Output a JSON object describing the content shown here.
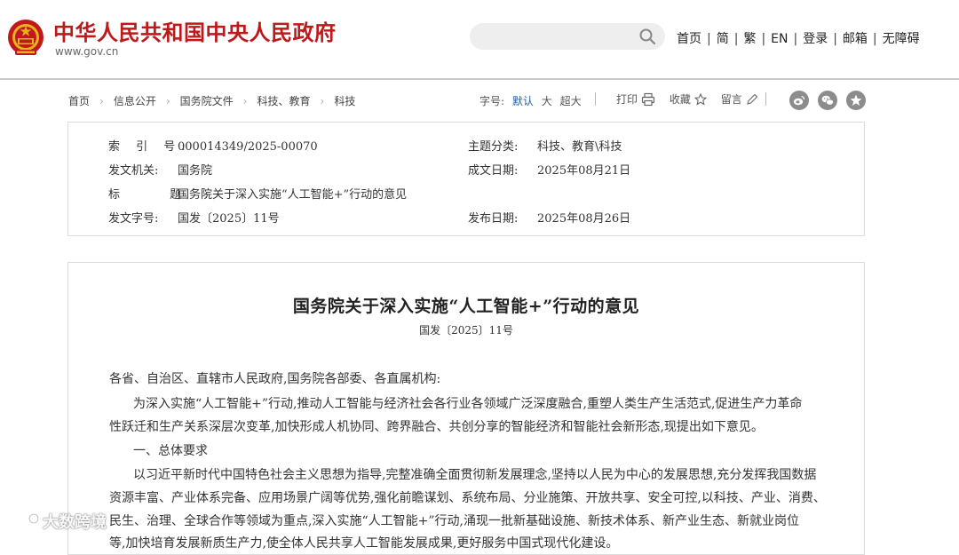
{
  "header": {
    "site_title": "中华人民共和国中央人民政府",
    "site_url": "www.gov.cn",
    "nav": [
      "首页",
      "简",
      "繁",
      "EN",
      "登录",
      "邮箱",
      "无障碍"
    ]
  },
  "breadcrumb": [
    "首页",
    "信息公开",
    "国务院文件",
    "科技、教育",
    "科技"
  ],
  "font_size": {
    "label": "字号:",
    "options": [
      "默认",
      "大",
      "超大"
    ],
    "active_color": "#1e5fa8"
  },
  "tools": {
    "print": "打印",
    "favorite": "收藏",
    "comment": "留言"
  },
  "share_icons": [
    "weibo-icon",
    "wechat-icon",
    "qzone-icon"
  ],
  "info": {
    "index_label": "索  引  号:",
    "index_value": "000014349/2025-00070",
    "topic_label": "主题分类:",
    "topic_value": "科技、教育\\科技",
    "issuer_label": "发文机关:",
    "issuer_value": "国务院",
    "written_label": "成文日期:",
    "written_value": "2025年08月21日",
    "title_label": "标    题:",
    "title_value": "国务院关于深入实施“人工智能+”行动的意见",
    "docno_label": "发文字号:",
    "docno_value": "国发〔2025〕11号",
    "published_label": "发布日期:",
    "published_value": "2025年08月26日"
  },
  "article": {
    "title": "国务院关于深入实施“人工智能+”行动的意见",
    "doc_number": "国发〔2025〕11号",
    "lines": [
      "各省、自治区、直辖市人民政府,国务院各部委、各直属机构:",
      "为深入实施“人工智能+”行动,推动人工智能与经济社会各行业各领域广泛深度融合,重塑人类生产生活范式,促进生产力革命",
      "性跃迁和生产关系深层次变革,加快形成人机协同、跨界融合、共创分享的智能经济和智能社会新形态,现提出如下意见。",
      "一、总体要求",
      "以习近平新时代中国特色社会主义思想为指导,完整准确全面贯彻新发展理念,坚持以人民为中心的发展思想,充分发挥我国数据",
      "资源丰富、产业体系完备、应用场景广阔等优势,强化前瞻谋划、系统布局、分业施策、开放共享、安全可控,以科技、产业、消费、",
      "民生、治理、全球合作等领域为重点,深入实施“人工智能+”行动,涌现一批新基础设施、新技术体系、新产业生态、新就业岗位",
      "等,加快培育发展新质生产力,使全体人民共享人工智能发展成果,更好服务中国式现代化建设。"
    ]
  },
  "watermark": "大数跨境",
  "colors": {
    "brand_red": "#c0191b",
    "link_blue": "#1e5fa8",
    "icon_gray": "#8c8c8c"
  }
}
